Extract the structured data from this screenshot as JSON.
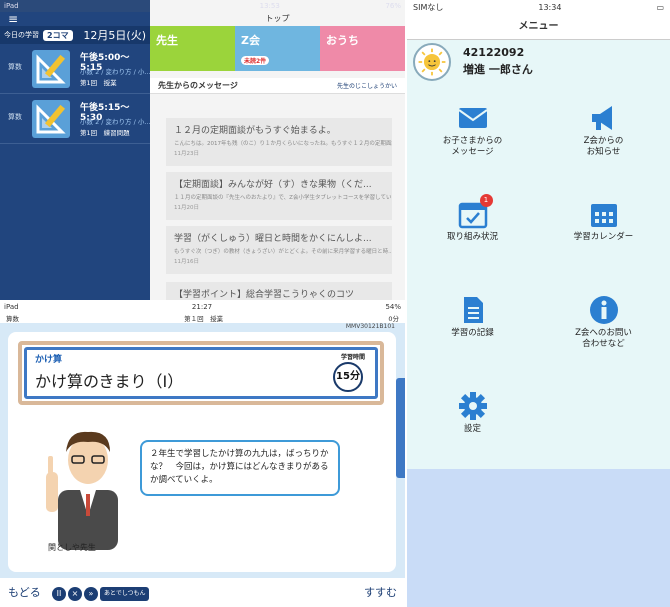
{
  "panel_a": {
    "status_left": "iPad",
    "status_time": "13:53",
    "status_battery": "76%",
    "date_label": "今日の学習",
    "koma": "2コマ",
    "date": "12月5日(火)",
    "lessons": [
      {
        "subject": "算数",
        "time": "午後5:00〜5:15",
        "unit": "小数 2 / 変わり方 / 小...",
        "no": "第1回　授業"
      },
      {
        "subject": "算数",
        "time": "午後5:15〜5:30",
        "unit": "小数 2 / 変わり方 / 小...",
        "no": "第1回　練習問題"
      }
    ],
    "header": "トップ",
    "banners": [
      {
        "label": "先生",
        "color": "#9bd43b"
      },
      {
        "label": "Z会",
        "color": "#6fb6e0",
        "badge": "未読2件"
      },
      {
        "label": "おうち",
        "color": "#ef8aa8"
      }
    ],
    "message_title": "先生からのメッセージ",
    "message_link": "先生のじこしょうかい",
    "messages": [
      {
        "title": "１２月の定期面談がもうすぐ始まるよ。",
        "body": "こんにちは。2017年も残（のこ）り１か月くらいになったね。もうすぐ１２月の定期面談...",
        "date": "11月23日"
      },
      {
        "title": "【定期面談】みんなが好（す）きな果物（くだ...",
        "body": "１１月の定期面談の『先生へのおたより』で、Z会小学生タブレットコースを学習してい...",
        "date": "11月20日"
      },
      {
        "title": "学習（がくしゅう）曜日と時間をかくにんしよ...",
        "body": "もうすぐ次（つぎ）の教材（きょうざい）がとどくよ。その前に来月学習する曜日と時...",
        "date": "11月16日"
      },
      {
        "title": "【学習ポイント】総合学習こうりゃくのコツ",
        "body": "",
        "date": ""
      }
    ]
  },
  "panel_b": {
    "status_left": "iPad",
    "status_time": "21:27",
    "status_battery": "54%",
    "subject": "算数",
    "session": "第１回　授業",
    "elapsed": "0分",
    "code": "MMV30121B101",
    "category": "かけ算",
    "title": "かけ算のきまり（Ⅰ）",
    "time_label": "学習時間",
    "minutes": "15分",
    "bubble": "２年生で学習したかけ算の九九は，ばっちりかな？　今回は，かけ算にはどんなきまりがあるか調べていくよ。",
    "teacher": "関としや先生",
    "back": "もどる",
    "later": "あとでしつもん",
    "next": "すすむ"
  },
  "panel_c": {
    "status_carrier": "SIMなし",
    "status_time": "13:34",
    "nav_title": "メニュー",
    "user_id": "42122092",
    "user_name": "増進 一郎さん",
    "menu": [
      {
        "label": "お子さまからの\nメッセージ",
        "icon": "envelope-icon"
      },
      {
        "label": "Z会からの\nお知らせ",
        "icon": "megaphone-icon"
      },
      {
        "label": "取り組み状況",
        "icon": "calendar-check-icon",
        "badge": "1"
      },
      {
        "label": "学習カレンダー",
        "icon": "calendar-icon"
      },
      {
        "label": "学習の記録",
        "icon": "document-icon"
      },
      {
        "label": "Z会へのお問い\n合わせなど",
        "icon": "info-icon"
      },
      {
        "label": "設定",
        "icon": "gear-icon"
      }
    ]
  },
  "colors": {
    "navy": "#21457e",
    "blue": "#2b7fd1",
    "menu_bg": "#e7f7f8"
  }
}
